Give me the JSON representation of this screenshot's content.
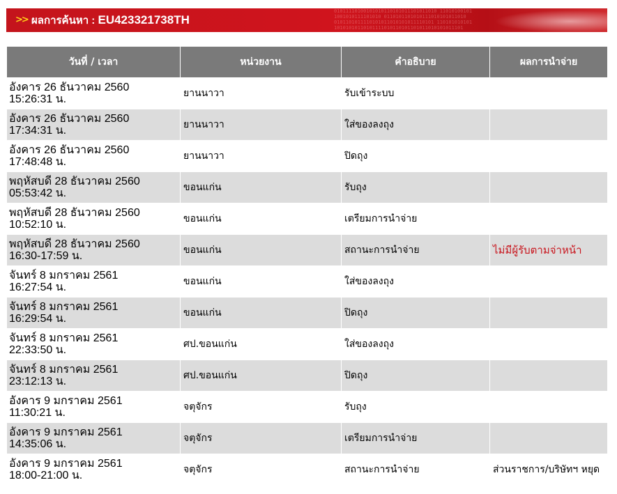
{
  "banner": {
    "arrow": ">>",
    "title_prefix": "ผลการค้นหา : ",
    "tracking_number": "EU423321738TH",
    "binary_text": "01011110100101010110101011101011010 11010100101\n1001010111101010 0110101101010111010101011010\n0101101011110101011010101011110101 110101010101\n10101010110101111010110101101011010101011101"
  },
  "table": {
    "headers": [
      "วันที่ / เวลา",
      "หน่วยงาน",
      "คำอธิบาย",
      "ผลการนำจ่าย"
    ],
    "rows": [
      {
        "date": "อังคาร 26 ธันวาคม 2560",
        "time": "15:26:31 น.",
        "office": "ยานนาวา",
        "description": "รับเข้าระบบ",
        "result": "",
        "alert": false
      },
      {
        "date": "อังคาร 26 ธันวาคม 2560",
        "time": "17:34:31 น.",
        "office": "ยานนาวา",
        "description": "ใส่ของลงถุง",
        "result": "",
        "alert": false
      },
      {
        "date": "อังคาร 26 ธันวาคม 2560",
        "time": "17:48:48 น.",
        "office": "ยานนาวา",
        "description": "ปิดถุง",
        "result": "",
        "alert": false
      },
      {
        "date": "พฤหัสบดี 28 ธันวาคม 2560",
        "time": "05:53:42 น.",
        "office": "ขอนแก่น",
        "description": "รับถุง",
        "result": "",
        "alert": false
      },
      {
        "date": "พฤหัสบดี 28 ธันวาคม 2560",
        "time": "10:52:10 น.",
        "office": "ขอนแก่น",
        "description": "เตรียมการนำจ่าย",
        "result": "",
        "alert": false
      },
      {
        "date": "พฤหัสบดี 28 ธันวาคม 2560",
        "time": "16:30-17:59 น.",
        "office": "ขอนแก่น",
        "description": "สถานะการนำจ่าย",
        "result": "ไม่มีผู้รับตามจ่าหน้า",
        "alert": true
      },
      {
        "date": "จันทร์ 8 มกราคม 2561",
        "time": "16:27:54 น.",
        "office": "ขอนแก่น",
        "description": "ใส่ของลงถุง",
        "result": "",
        "alert": false
      },
      {
        "date": "จันทร์ 8 มกราคม 2561",
        "time": "16:29:54 น.",
        "office": "ขอนแก่น",
        "description": "ปิดถุง",
        "result": "",
        "alert": false
      },
      {
        "date": "จันทร์ 8 มกราคม 2561",
        "time": "22:33:50 น.",
        "office": "ศป.ขอนแก่น",
        "description": "ใส่ของลงถุง",
        "result": "",
        "alert": false
      },
      {
        "date": "จันทร์ 8 มกราคม 2561",
        "time": "23:12:13 น.",
        "office": "ศป.ขอนแก่น",
        "description": "ปิดถุง",
        "result": "",
        "alert": false
      },
      {
        "date": "อังคาร 9 มกราคม 2561",
        "time": "11:30:21 น.",
        "office": "จตุจักร",
        "description": "รับถุง",
        "result": "",
        "alert": false
      },
      {
        "date": "อังคาร 9 มกราคม 2561",
        "time": "14:35:06 น.",
        "office": "จตุจักร",
        "description": "เตรียมการนำจ่าย",
        "result": "",
        "alert": false
      },
      {
        "date": "อังคาร 9 มกราคม 2561",
        "time": "18:00-21:00 น.",
        "office": "จตุจักร",
        "description": "สถานะการนำจ่าย",
        "result": "ส่วนราชการ/บริษัทฯ หยุด",
        "alert": false
      }
    ]
  },
  "colors": {
    "banner_red": "#c4141c",
    "arrow_yellow": "#ffd21a",
    "header_gray": "#7a7a7a",
    "row_alt_gray": "#dcdcdc",
    "alert_red": "#c8141c"
  }
}
